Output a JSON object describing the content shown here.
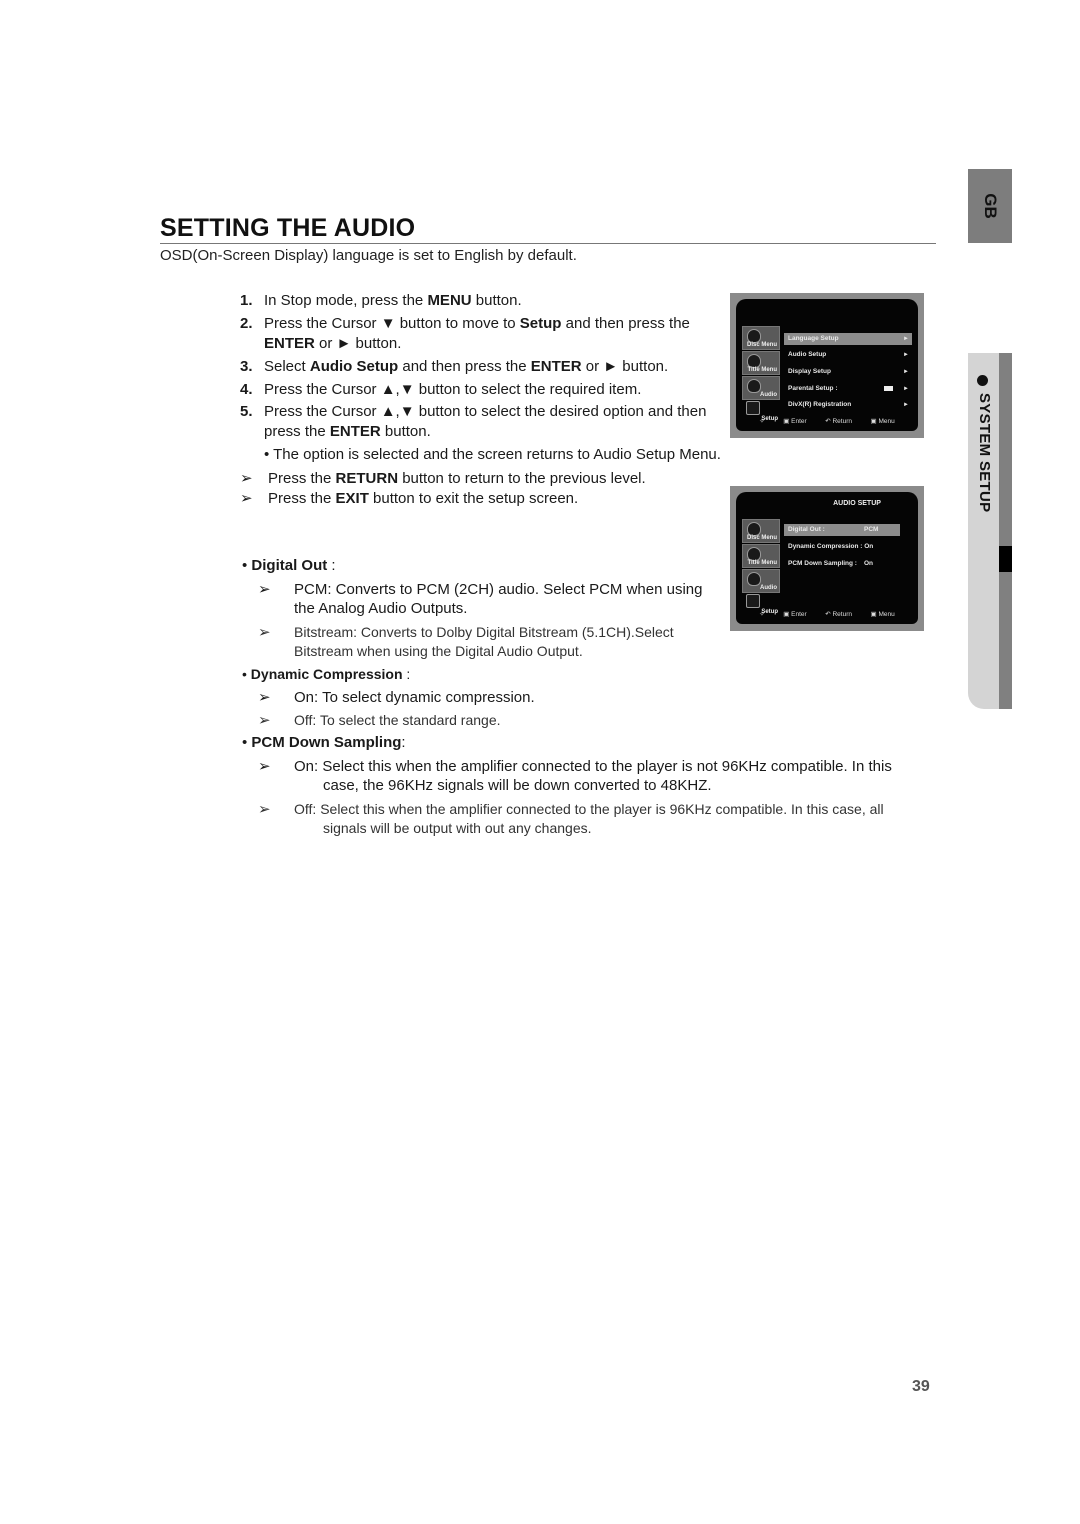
{
  "page": {
    "title": "SETTING THE AUDIO",
    "intro": "OSD(On-Screen Display) language is set to English by default.",
    "page_number": "39"
  },
  "side_tabs": {
    "language_tab": "GB",
    "section_tab": "SYSTEM SETUP"
  },
  "steps": [
    {
      "num": "1.",
      "pre": "In Stop mode, press the ",
      "b1": "MENU",
      "post": " button."
    },
    {
      "num": "2.",
      "pre": "Press the Cursor ▼ button to move to ",
      "b1": "Setup",
      "mid": " and then press the",
      "line2_b": "ENTER",
      "line2_post": " or ► button."
    },
    {
      "num": "3.",
      "pre": "Select ",
      "b1": "Audio Setup",
      "mid": " and then press the ",
      "b2": "ENTER",
      "post": " or ► button."
    },
    {
      "num": "4.",
      "pre": "Press the Cursor ▲,▼ button to select the required item."
    },
    {
      "num": "5.",
      "pre": "Press the Cursor ▲,▼ button to select the desired option and then",
      "line2_pre": "press the ",
      "line2_b": "ENTER",
      "line2_post": " button."
    }
  ],
  "step_note": "• The option is selected and the screen returns to Audio Setup Menu.",
  "tips": [
    {
      "arrow": "➢",
      "pre": "Press the ",
      "b": "RETURN",
      "post": " button to return to the previous level."
    },
    {
      "arrow": "➢",
      "pre": "Press the ",
      "b": "EXIT",
      "post": " button to exit the setup screen."
    }
  ],
  "options": {
    "digital_out": {
      "label": "Digital Out",
      "suffix": " :",
      "items": [
        {
          "arrow": "➢",
          "line1": "PCM: Converts to PCM (2CH) audio. Select PCM when using",
          "line2": "the Analog Audio Outputs."
        },
        {
          "arrow": "➢",
          "line1": "Bitstream: Converts to Dolby Digital Bitstream (5.1CH).Select",
          "line2": "Bitstream when using the Digital Audio Output."
        }
      ]
    },
    "dynamic_compression": {
      "label": "Dynamic Compression",
      "suffix": " :",
      "items": [
        {
          "arrow": "➢",
          "line1": "On: To select dynamic compression."
        },
        {
          "arrow": "➢",
          "line1": "Off: To select the standard range."
        }
      ]
    },
    "pcm_down_sampling": {
      "label": "PCM Down Sampling",
      "suffix": ":",
      "items": [
        {
          "arrow": "➢",
          "line1": "On: Select this when the amplifier connected to the player is not 96KHz compatible. In this",
          "line2": "case, the 96KHz signals will be down converted to 48KHZ."
        },
        {
          "arrow": "➢",
          "line1": "Off: Select this when the amplifier connected to the player is 96KHz compatible. In this case, all",
          "line2": "signals will be output with out any changes."
        }
      ]
    }
  },
  "osd_setup_menu": {
    "side": [
      "Disc Menu",
      "Title Menu",
      "Audio",
      "Setup"
    ],
    "rows": [
      {
        "label": "Language Setup",
        "arrow": "►",
        "selected": true
      },
      {
        "label": "Audio Setup",
        "arrow": "►"
      },
      {
        "label": "Display Setup",
        "arrow": "►"
      },
      {
        "label": "Parental Setup :",
        "arrow": "►"
      },
      {
        "label": "DivX(R) Registration",
        "arrow": "►"
      }
    ],
    "footer": [
      "✧",
      "Enter",
      "Return",
      "Menu"
    ]
  },
  "osd_audio_setup": {
    "header": "AUDIO SETUP",
    "side": [
      "Disc Menu",
      "Title Menu",
      "Audio",
      "Setup"
    ],
    "rows": [
      {
        "label": "Digital Out :",
        "value": "PCM",
        "selected": true
      },
      {
        "label": "Dynamic Compression : On"
      },
      {
        "label": "PCM Down Sampling :",
        "value": "On"
      }
    ],
    "footer": [
      "✧",
      "Enter",
      "Return",
      "Menu"
    ]
  },
  "colors": {
    "gb_tab": "#7d7d7d",
    "section_tab_light": "#d4d4d4",
    "section_tab_dark": "#808080",
    "osd_bg": "#050505",
    "osd_highlight": "#8c8c8c"
  }
}
